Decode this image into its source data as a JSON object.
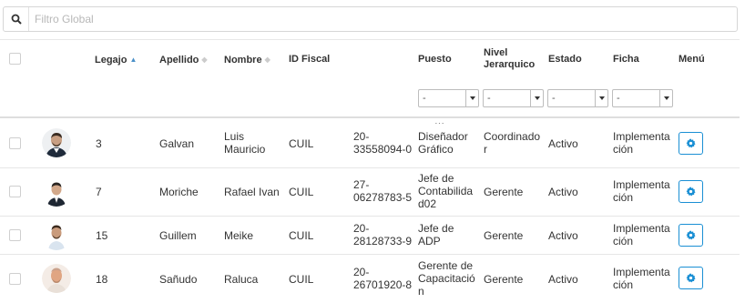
{
  "search": {
    "placeholder": "Filtro Global",
    "value": ""
  },
  "table": {
    "headers": {
      "legajo": "Legajo",
      "apellido": "Apellido",
      "nombre": "Nombre",
      "id_fiscal": "ID Fiscal",
      "puesto": "Puesto",
      "nivel_jerarquico_line1": "Nivel",
      "nivel_jerarquico_line2": "Jerarquico",
      "estado": "Estado",
      "ficha": "Ficha",
      "menu": "Menú"
    },
    "sorted_column": "legajo",
    "filters": {
      "puesto": "-",
      "nivel_jerarquico": "-",
      "estado": "-",
      "ficha": "-"
    },
    "rows": [
      {
        "legajo": "3",
        "apellido": "Galvan",
        "nombre_l1": "Luis",
        "nombre_l2": "Mauricio",
        "tipo_fiscal": "CUIL",
        "id_l1": "20-",
        "id_l2": "33558094-0",
        "puesto_l1": "Diseñador",
        "puesto_l2": "Gráfico",
        "puesto_l3": "",
        "nivel_l1": "Coordinado",
        "nivel_l2": "r",
        "estado": "Activo",
        "ficha_l1": "Implementa",
        "ficha_l2": "ción"
      },
      {
        "legajo": "7",
        "apellido": "Moriche",
        "nombre_l1": "Rafael Ivan",
        "nombre_l2": "",
        "tipo_fiscal": "CUIL",
        "id_l1": "27-",
        "id_l2": "06278783-5",
        "puesto_l1": "Jefe de",
        "puesto_l2": "Contabilida",
        "puesto_l3": "d02",
        "nivel_l1": "Gerente",
        "nivel_l2": "",
        "estado": "Activo",
        "ficha_l1": "Implementa",
        "ficha_l2": "ción"
      },
      {
        "legajo": "15",
        "apellido": "Guillem",
        "nombre_l1": "Meike",
        "nombre_l2": "",
        "tipo_fiscal": "CUIL",
        "id_l1": "20-",
        "id_l2": "28128733-9",
        "puesto_l1": "Jefe de",
        "puesto_l2": "ADP",
        "puesto_l3": "",
        "nivel_l1": "Gerente",
        "nivel_l2": "",
        "estado": "Activo",
        "ficha_l1": "Implementa",
        "ficha_l2": "ción"
      },
      {
        "legajo": "18",
        "apellido": "Sañudo",
        "nombre_l1": "Raluca",
        "nombre_l2": "",
        "tipo_fiscal": "CUIL",
        "id_l1": "20-",
        "id_l2": "26701920-8",
        "puesto_l1": "Gerente de",
        "puesto_l2": "Capacitació",
        "puesto_l3": "n",
        "nivel_l1": "Gerente",
        "nivel_l2": "",
        "estado": "Activo",
        "ficha_l1": "Implementa",
        "ficha_l2": "ción"
      }
    ]
  },
  "icons": {
    "search": "search-icon",
    "sort_asc": "sort-asc-icon",
    "sort": "sort-icon",
    "menu_gear": "gear-icon",
    "dropdown": "chevron-down-icon"
  },
  "colors": {
    "accent": "#1a8fd4",
    "sort_active": "#4a90c8"
  }
}
